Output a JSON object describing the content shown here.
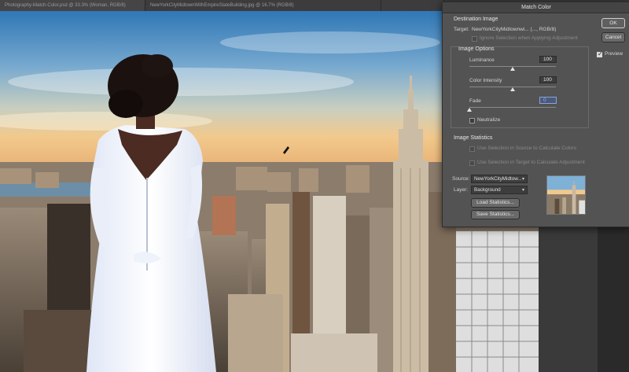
{
  "tabs": [
    "Photography-Match-Color.psd @ 33.3% (Woman, RGB/8)",
    "NewYorkCityMidtownWithEmpireStateBuilding.jpg @ 16.7% (RGB/8)",
    "Match Color"
  ],
  "dialog": {
    "title": "Match Color",
    "destination": {
      "heading": "Destination Image",
      "target_label": "Target:",
      "target_value": "NewYorkCityMidtownwi... (..., RGB/8)",
      "ignore_selection": "Ignore Selection when Applying Adjustment"
    },
    "image_options": {
      "heading": "Image Options",
      "luminance_label": "Luminance",
      "luminance_value": "100",
      "luminance_level": 0.5,
      "intensity_label": "Color Intensity",
      "intensity_value": "100",
      "intensity_level": 0.5,
      "fade_label": "Fade",
      "fade_value": "0",
      "fade_level": 0,
      "neutralize_label": "Neutralize"
    },
    "image_statistics": {
      "heading": "Image Statistics",
      "use_source_selection": "Use Selection in Source to Calculate Colors",
      "use_target_selection": "Use Selection in Target to Calculate Adjustment",
      "source_label": "Source:",
      "source_value": "NewYorkCityMidtow...",
      "layer_label": "Layer:",
      "layer_value": "Background",
      "load_button": "Load Statistics...",
      "save_button": "Save Statistics..."
    },
    "ok_label": "OK",
    "cancel_label": "Cancel",
    "preview_label": "Preview",
    "preview_checked": true
  }
}
